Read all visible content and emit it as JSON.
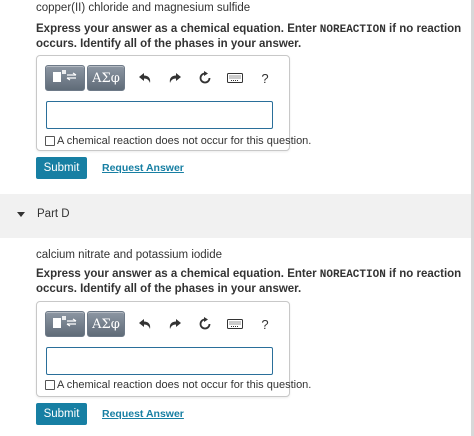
{
  "partC": {
    "reactants": "copper(II) chloride and magnesium sulfide",
    "instruction_pre": "Express your answer as a chemical equation. Enter ",
    "instruction_keyword": "NOREACTION",
    "instruction_post": " if no reaction occurs. Identify all of the phases in your answer.",
    "toolbar": {
      "greek_label": "ΑΣφ",
      "help_label": "?"
    },
    "answer_value": "",
    "no_reaction_label": "A chemical reaction does not occur for this question.",
    "submit_label": "Submit",
    "request_label": "Request Answer"
  },
  "partD": {
    "title": "Part D",
    "reactants": "calcium nitrate and potassium iodide",
    "instruction_pre": "Express your answer as a chemical equation. Enter ",
    "instruction_keyword": "NOREACTION",
    "instruction_post": " if no reaction occurs. Identify all of the phases in your answer.",
    "toolbar": {
      "greek_label": "ΑΣφ",
      "help_label": "?"
    },
    "answer_value": "",
    "no_reaction_label": "A chemical reaction does not occur for this question.",
    "submit_label": "Submit",
    "request_label": "Request Answer"
  },
  "colors": {
    "accent": "#177fa3",
    "input_border": "#2a6f9a",
    "toolbar_button": "#6e7a88"
  },
  "icons": [
    "template-icon",
    "undo-icon",
    "redo-icon",
    "reset-icon",
    "keyboard-icon",
    "help-icon",
    "caret-down-icon"
  ]
}
